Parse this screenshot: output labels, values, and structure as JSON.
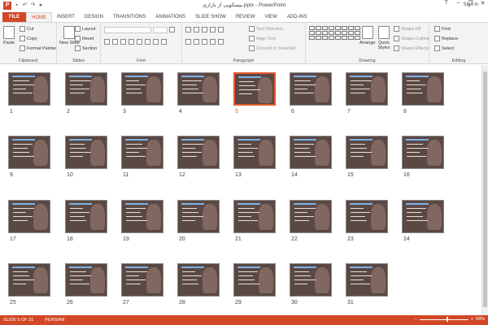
{
  "window": {
    "title": "بیسکویی از بازاری.pptx - PowerPoint",
    "app_icon": "P",
    "minimize": "–",
    "restore": "❐",
    "close": "✕",
    "help": "?"
  },
  "tabs": [
    "FILE",
    "HOME",
    "INSERT",
    "DESIGN",
    "TRANSITIONS",
    "ANIMATIONS",
    "SLIDE SHOW",
    "REVIEW",
    "VIEW",
    "ADD-INS"
  ],
  "active_tab": "HOME",
  "signin": "Sign in",
  "ribbon": {
    "clipboard": {
      "label": "Clipboard",
      "paste": "Paste",
      "cut": "Cut",
      "copy": "Copy",
      "format_painter": "Format Painter"
    },
    "slides": {
      "label": "Slides",
      "new_slide": "New Slide",
      "layout": "Layout",
      "reset": "Reset",
      "section": "Section"
    },
    "font": {
      "label": "Font"
    },
    "paragraph": {
      "label": "Paragraph",
      "text_direction": "Text Direction",
      "align_text": "Align Text",
      "convert_smartart": "Convert to SmartArt"
    },
    "drawing": {
      "label": "Drawing",
      "arrange": "Arrange",
      "quick_styles": "Quick Styles",
      "shape_fill": "Shape Fill",
      "shape_outline": "Shape Outline",
      "shape_effects": "Shape Effects"
    },
    "editing": {
      "label": "Editing",
      "find": "Find",
      "replace": "Replace",
      "select": "Select"
    }
  },
  "slides": [
    {
      "num": "1"
    },
    {
      "num": "2"
    },
    {
      "num": "3"
    },
    {
      "num": "4"
    },
    {
      "num": "5",
      "selected": true
    },
    {
      "num": "6"
    },
    {
      "num": "7"
    },
    {
      "num": "8"
    },
    {
      "num": "9"
    },
    {
      "num": "10"
    },
    {
      "num": "11"
    },
    {
      "num": "12"
    },
    {
      "num": "13"
    },
    {
      "num": "14"
    },
    {
      "num": "15"
    },
    {
      "num": "16"
    },
    {
      "num": "17"
    },
    {
      "num": "18"
    },
    {
      "num": "19"
    },
    {
      "num": "20"
    },
    {
      "num": "21"
    },
    {
      "num": "22"
    },
    {
      "num": "23"
    },
    {
      "num": "24"
    },
    {
      "num": "25"
    },
    {
      "num": "26"
    },
    {
      "num": "27"
    },
    {
      "num": "28"
    },
    {
      "num": "29"
    },
    {
      "num": "30"
    },
    {
      "num": "31"
    }
  ],
  "status": {
    "slide_info": "SLIDE 5 OF 31",
    "language": "PERSIAN",
    "zoom_minus": "–",
    "zoom_plus": "+",
    "zoom": "58%",
    "zoom_level": 0.58
  },
  "colors": {
    "accent": "#d24726",
    "selection": "#e35b2f",
    "slide_bg": "#5a4844"
  }
}
